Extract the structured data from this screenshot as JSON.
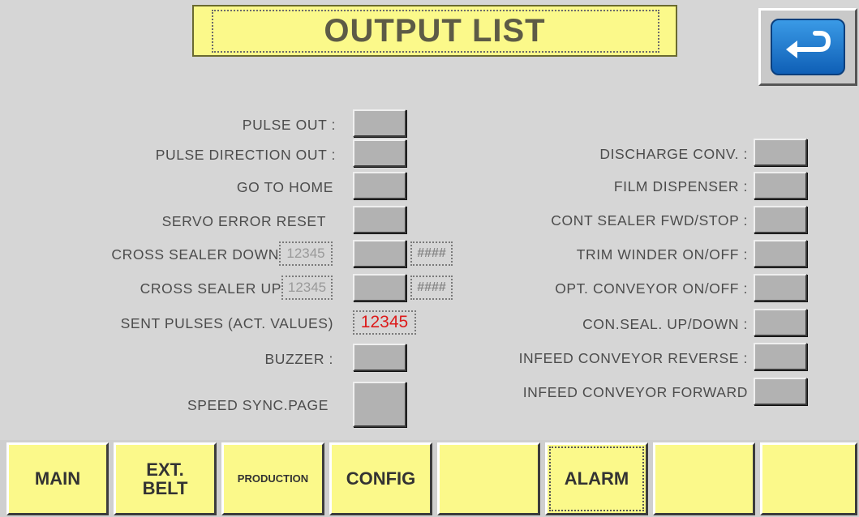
{
  "title": "OUTPUT LIST",
  "back_icon": "return-arrow-icon",
  "left_rows": [
    {
      "label": "PULSE OUT :"
    },
    {
      "label": "PULSE DIRECTION OUT :"
    },
    {
      "label": "GO TO HOME"
    },
    {
      "label": "SERVO ERROR RESET"
    },
    {
      "label": "CROSS SEALER DOWN",
      "value": "12345",
      "hash": "####"
    },
    {
      "label": "CROSS SEALER UP",
      "value": "12345",
      "hash": "####"
    },
    {
      "label": "SENT PULSES (ACT. VALUES)",
      "value": "12345"
    },
    {
      "label": "BUZZER :"
    },
    {
      "label": "SPEED SYNC.PAGE"
    }
  ],
  "right_rows": [
    {
      "label": "DISCHARGE CONV. :"
    },
    {
      "label": "FILM DISPENSER :"
    },
    {
      "label": "CONT SEALER FWD/STOP :"
    },
    {
      "label": "TRIM WINDER ON/OFF :"
    },
    {
      "label": "OPT. CONVEYOR ON/OFF :"
    },
    {
      "label": "CON.SEAL. UP/DOWN :"
    },
    {
      "label": "INFEED CONVEYOR REVERSE :"
    },
    {
      "label": "INFEED CONVEYOR FORWARD"
    }
  ],
  "nav": [
    {
      "label": "MAIN"
    },
    {
      "label": "EXT.\nBELT"
    },
    {
      "label": "PRODUCTION"
    },
    {
      "label": "CONFIG"
    },
    {
      "label": ""
    },
    {
      "label": "ALARM"
    },
    {
      "label": ""
    },
    {
      "label": ""
    }
  ],
  "colors": {
    "background": "#d6d6d6",
    "title_bg": "#fbf98a",
    "button_gray": "#b2b2b2",
    "nav_yellow": "#fbf98a",
    "value_red": "#dd1b1b",
    "back_blue": "#1e78d2"
  }
}
